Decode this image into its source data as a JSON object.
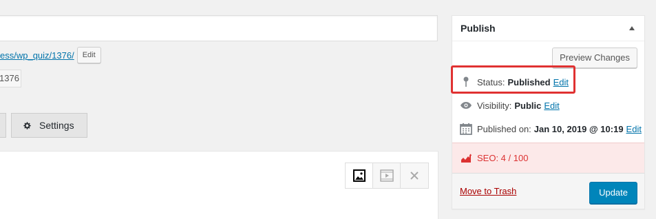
{
  "editor": {
    "permalink_text": "ess/wp_quiz/1376/",
    "permalink_edit_label": "Edit",
    "shortlink_value": "1376",
    "settings_tab_label": "Settings",
    "media_buttons": [
      "image-icon",
      "video-icon",
      "close-icon"
    ]
  },
  "publish": {
    "title": "Publish",
    "preview_label": "Preview Changes",
    "status_label": "Status:",
    "status_value": "Published",
    "status_edit": "Edit",
    "visibility_label": "Visibility:",
    "visibility_value": "Public",
    "visibility_edit": "Edit",
    "published_on_label": "Published on:",
    "published_on_value": "Jan 10, 2019 @ 10:19",
    "published_on_edit": "Edit",
    "seo_text": "SEO: 4 / 100",
    "trash_label": "Move to Trash",
    "update_label": "Update"
  },
  "colors": {
    "link": "#0073aa",
    "primary_button": "#0085ba",
    "seo_bad": "#dc3232",
    "seo_bg": "#fce9e9",
    "highlight": "#e03131",
    "trash": "#a00000"
  }
}
